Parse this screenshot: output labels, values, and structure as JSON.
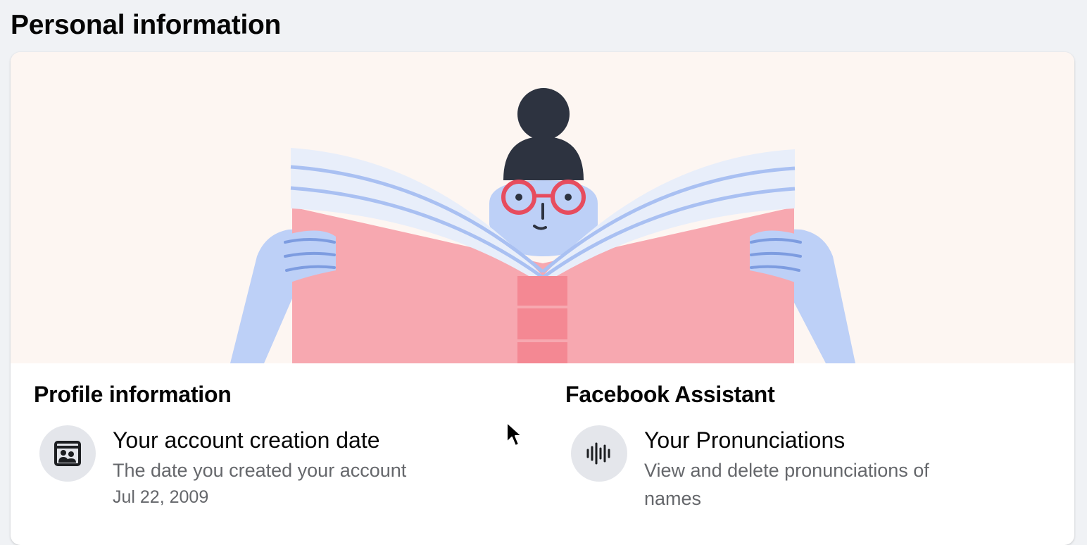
{
  "page": {
    "title": "Personal information"
  },
  "colors": {
    "page_background": "#f0f2f5",
    "hero_background": "#fdf6f2",
    "book_cover": "#f7a8b0",
    "book_spine": "#f48893",
    "pages": "#e8eefa",
    "page_lines": "#a9c0f2",
    "skin": "#bdd0f7",
    "hair": "#2d3340",
    "glasses": "#e74c5e",
    "icon_circle": "#e4e6eb",
    "secondary_text": "#65676b"
  },
  "hero": {
    "illustration": "person-reading-book-illustration"
  },
  "sections": {
    "profile": {
      "heading": "Profile information",
      "item": {
        "icon": "profile-card-icon",
        "title": "Your account creation date",
        "description": "The date you created your account",
        "meta": "Jul 22, 2009"
      }
    },
    "assistant": {
      "heading": "Facebook Assistant",
      "item": {
        "icon": "audio-waveform-icon",
        "title": "Your Pronunciations",
        "description": "View and delete pronunciations of names"
      }
    }
  }
}
